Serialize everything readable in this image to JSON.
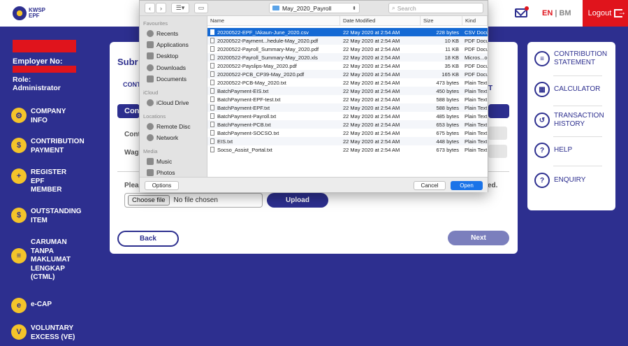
{
  "header": {
    "logo_line1": "KWSP",
    "logo_line2": "EPF",
    "lang_en": "EN",
    "lang_sep": "|",
    "lang_bm": "BM",
    "logout": "Logout"
  },
  "sidebar": {
    "employer_label": "Employer No:",
    "role_line1": "Role:",
    "role_line2": "Administrator",
    "items": [
      {
        "label": "COMPANY INFO",
        "icon": "gear-icon"
      },
      {
        "label": "CONTRIBUTION PAYMENT",
        "icon": "payment-icon"
      },
      {
        "label": "REGISTER EPF MEMBER",
        "icon": "register-member-icon"
      },
      {
        "label": "OUTSTANDING ITEM",
        "icon": "outstanding-icon"
      },
      {
        "label": "CARUMAN TANPA MAKLUMAT LENGKAP (CTML)",
        "icon": "document-icon"
      },
      {
        "label": "e-CAP",
        "icon": "ecap-icon"
      },
      {
        "label": "VOLUNTARY EXCESS (VE)",
        "icon": "voluntary-icon"
      }
    ]
  },
  "main": {
    "title_fragment": "Subr",
    "cont_fragment": "CONT",
    "strip_fragment": "Con",
    "label_cont": "Cont",
    "label_wag": "Wag",
    "please_fragment": "Plea",
    "choose_file": "Choose file",
    "no_file": "No file chosen",
    "upload": "Upload",
    "ed_fragment": "ed.",
    "t_fragment": "T",
    "back": "Back",
    "next": "Next"
  },
  "right_menu": [
    {
      "label": "CONTRIBUTION STATEMENT",
      "icon": "statement-icon"
    },
    {
      "label": "CALCULATOR",
      "icon": "calculator-icon"
    },
    {
      "label": "TRANSACTION HISTORY",
      "icon": "history-icon"
    },
    {
      "label": "HELP",
      "icon": "help-icon"
    },
    {
      "label": "ENQUIRY",
      "icon": "enquiry-icon"
    }
  ],
  "dialog": {
    "path": "May_2020_Payroll",
    "search_placeholder": "Search",
    "favourites_header": "Favourites",
    "favourites": [
      "Recents",
      "Applications",
      "Desktop",
      "Downloads",
      "Documents"
    ],
    "icloud_header": "iCloud",
    "icloud": [
      "iCloud Drive"
    ],
    "locations_header": "Locations",
    "locations": [
      "Remote Disc",
      "Network"
    ],
    "media_header": "Media",
    "media": [
      "Music",
      "Photos"
    ],
    "columns": {
      "name": "Name",
      "modified": "Date Modified",
      "size": "Size",
      "kind": "Kind"
    },
    "files": [
      {
        "name": "20200522-EPF_IAkaun-June_2020.csv",
        "modified": "22 May 2020 at 2:54 AM",
        "size": "228 bytes",
        "kind": "CSV Docu"
      },
      {
        "name": "20200522-Payment...hedule-May_2020.pdf",
        "modified": "22 May 2020 at 2:54 AM",
        "size": "10 KB",
        "kind": "PDF Docu"
      },
      {
        "name": "20200522-Payroll_Summary-May_2020.pdf",
        "modified": "22 May 2020 at 2:54 AM",
        "size": "11 KB",
        "kind": "PDF Docu"
      },
      {
        "name": "20200522-Payroll_Summary-May_2020.xls",
        "modified": "22 May 2020 at 2:54 AM",
        "size": "18 KB",
        "kind": "Micros...o"
      },
      {
        "name": "20200522-Payslips-May_2020.pdf",
        "modified": "22 May 2020 at 2:54 AM",
        "size": "35 KB",
        "kind": "PDF Docu"
      },
      {
        "name": "20200522-PCB_CP39-May_2020.pdf",
        "modified": "22 May 2020 at 2:54 AM",
        "size": "165 KB",
        "kind": "PDF Docu"
      },
      {
        "name": "20200522-PCB-May_2020.txt",
        "modified": "22 May 2020 at 2:54 AM",
        "size": "473 bytes",
        "kind": "Plain Text"
      },
      {
        "name": "BatchPayment-EIS.txt",
        "modified": "22 May 2020 at 2:54 AM",
        "size": "450 bytes",
        "kind": "Plain Text"
      },
      {
        "name": "BatchPayment-EPF-test.txt",
        "modified": "22 May 2020 at 2:54 AM",
        "size": "588 bytes",
        "kind": "Plain Text"
      },
      {
        "name": "BatchPayment-EPF.txt",
        "modified": "22 May 2020 at 2:54 AM",
        "size": "588 bytes",
        "kind": "Plain Text"
      },
      {
        "name": "BatchPayment-Payroll.txt",
        "modified": "22 May 2020 at 2:54 AM",
        "size": "485 bytes",
        "kind": "Plain Text"
      },
      {
        "name": "BatchPayment-PCB.txt",
        "modified": "22 May 2020 at 2:54 AM",
        "size": "653 bytes",
        "kind": "Plain Text"
      },
      {
        "name": "BatchPayment-SOCSO.txt",
        "modified": "22 May 2020 at 2:54 AM",
        "size": "675 bytes",
        "kind": "Plain Text"
      },
      {
        "name": "EIS.txt",
        "modified": "22 May 2020 at 2:54 AM",
        "size": "448 bytes",
        "kind": "Plain Text"
      },
      {
        "name": "Socso_Assist_Portal.txt",
        "modified": "22 May 2020 at 2:54 AM",
        "size": "673 bytes",
        "kind": "Plain Text"
      }
    ],
    "options": "Options",
    "cancel": "Cancel",
    "open": "Open"
  },
  "colors": {
    "brand_blue": "#2d2f8f",
    "brand_red": "#e0141c",
    "accent_yellow": "#f4c42a",
    "selection_blue": "#1469d4"
  }
}
